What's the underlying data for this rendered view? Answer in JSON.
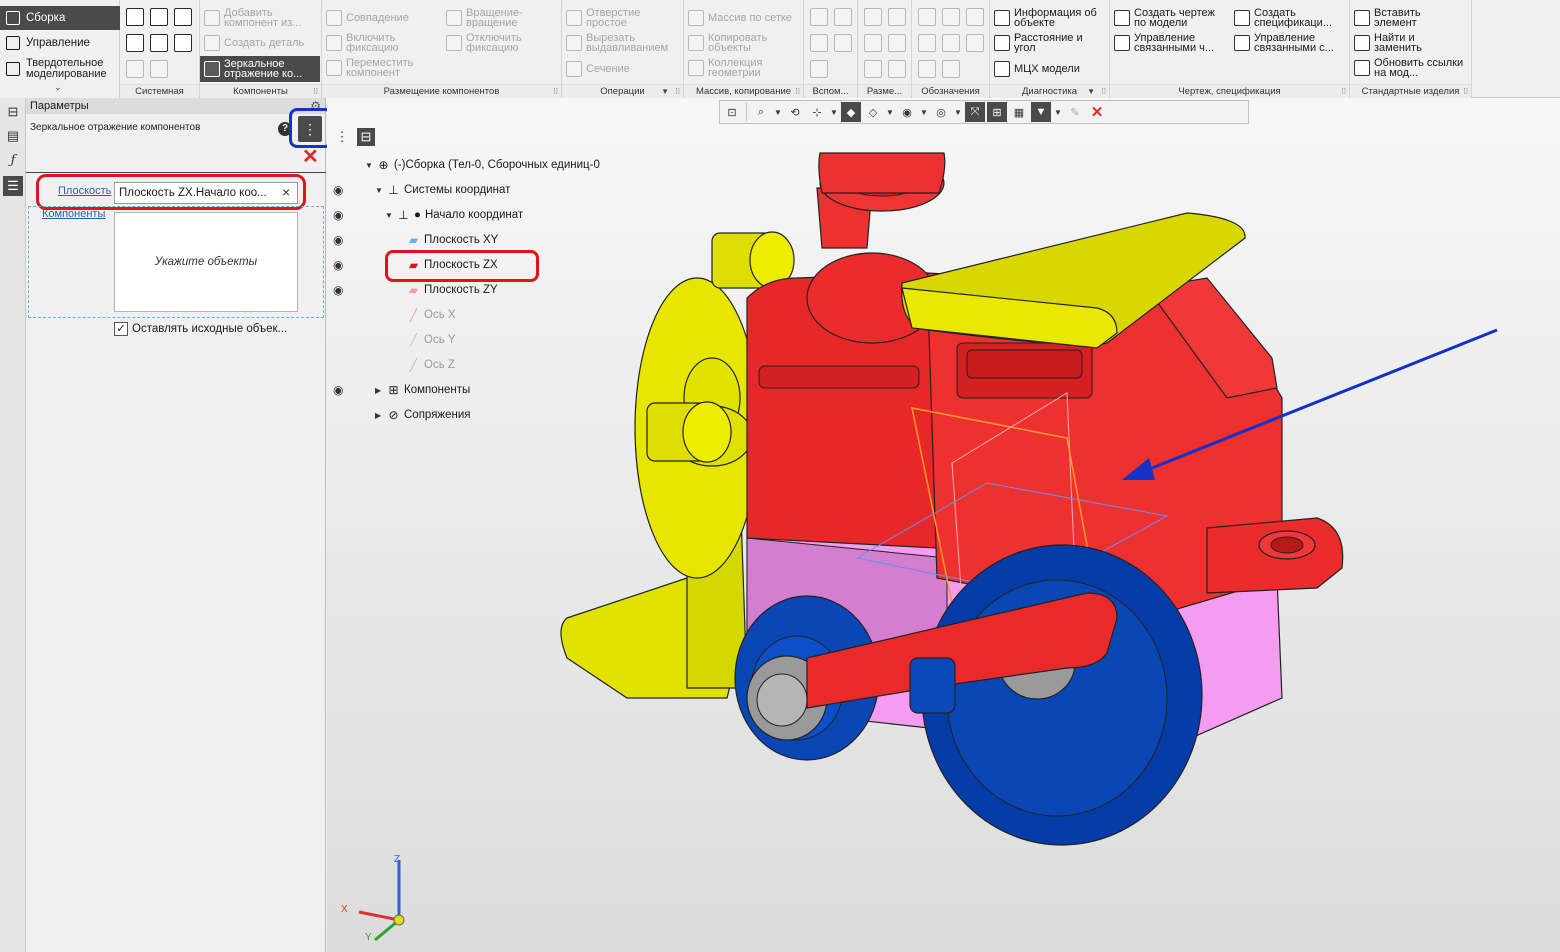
{
  "modes": [
    {
      "label": "Сборка"
    },
    {
      "label": "Управление"
    },
    {
      "label": "Твердотельное моделирование"
    }
  ],
  "ribbon": {
    "groups": {
      "system": "Системная",
      "components": "Компоненты",
      "placement": "Размещение компонентов",
      "operations": "Операции",
      "array": "Массив, копирование",
      "aux": "Вспом...",
      "dims": "Разме...",
      "designations": "Обозначения",
      "diagnostics": "Диагностика",
      "drawing": "Чертеж, спецификация",
      "standard": "Стандартные изделия"
    },
    "components": {
      "add": "Добавить компонент из...",
      "create_part": "Создать деталь",
      "mirror": "Зеркальное отражение ко..."
    },
    "placement": {
      "coincidence": "Совпадение",
      "rotation": "Вращение-вращение",
      "fix_on": "Включить фиксацию",
      "fix_off": "Отключить фиксацию",
      "move": "Переместить компонент"
    },
    "operations": {
      "hole": "Отверстие простое",
      "cut": "Вырезать выдавливанием",
      "section": "Сечение"
    },
    "array": {
      "grid": "Массив по сетке",
      "copy": "Копировать объекты",
      "collection": "Коллекция геометрии"
    },
    "diagnostics": {
      "info": "Информация об объекте",
      "distance": "Расстояние и угол",
      "mass": "МЦХ модели"
    },
    "drawing": {
      "create_drawing": "Создать чертеж по модели",
      "manage_linked": "Управление связанными ч...",
      "create_spec": "Создать спецификаци...",
      "manage_spec": "Управление связанными с..."
    },
    "standard": {
      "insert": "Вставить элемент",
      "find_replace": "Найти и заменить",
      "update_links": "Обновить ссылки на мод..."
    }
  },
  "params": {
    "header": "Параметры",
    "command_title": "Зеркальное отражение компонентов",
    "plane_label": "Плоскость",
    "plane_value": "Плоскость ZX.Начало коо...",
    "components_label": "Компоненты",
    "components_hint": "Укажите объекты",
    "keep_label": "Оставлять исходные объек..."
  },
  "tree": {
    "root": "(-)Сборка (Тел-0, Сборочных единиц-0",
    "coord_systems": "Системы координат",
    "origin": "Начало координат",
    "plane_xy": "Плоскость XY",
    "plane_zx": "Плоскость ZX",
    "plane_zy": "Плоскость ZY",
    "axis_x": "Ось X",
    "axis_y": "Ось Y",
    "axis_z": "Ось Z",
    "components": "Компоненты",
    "mates": "Сопряжения"
  },
  "triad": {
    "x": "X",
    "y": "Y",
    "z": "Z"
  },
  "colors": {
    "accent_dark": "#4a4a4a",
    "highlight_red": "#e1131c",
    "highlight_blue": "#1431c8",
    "body_red": "#f03434",
    "yellow": "#e2e200",
    "wheel_blue": "#0a46b4",
    "pink": "#f49cf0"
  }
}
